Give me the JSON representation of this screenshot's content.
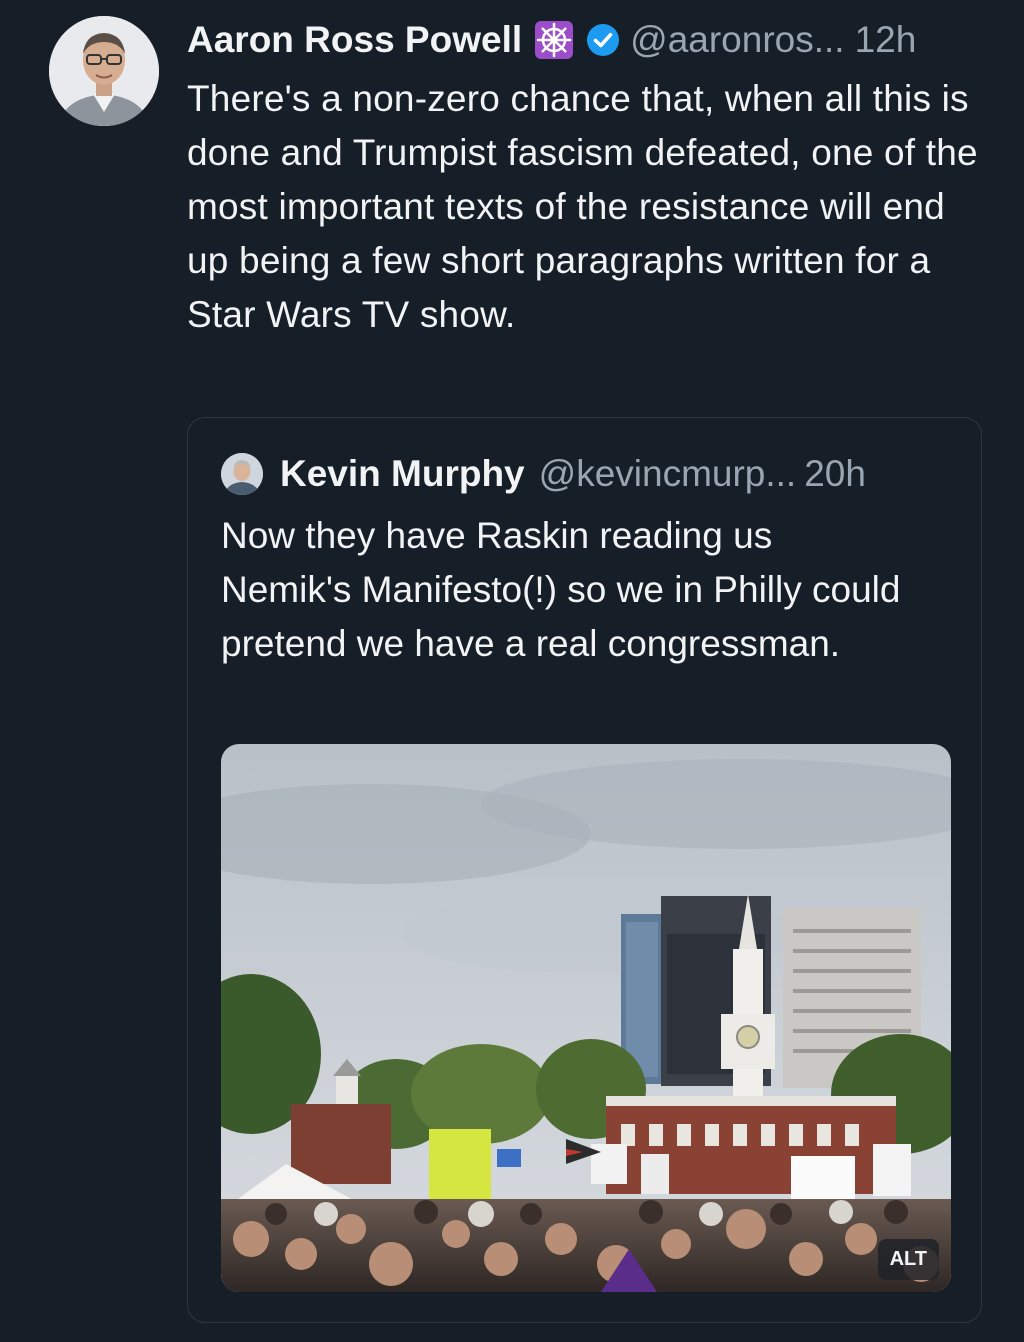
{
  "post": {
    "author": {
      "display_name": "Aaron Ross Powell",
      "handle": "@aaronros...",
      "verified_icon": "verified-check-icon",
      "extra_badge_icon": "ship-wheel-icon",
      "accent_color": "#9b4dca"
    },
    "timestamp": "12h",
    "text": "There's a non-zero chance that, when all this is done and Trumpist fascism defeated, one of the most important texts of the resistance will end up being a few short paragraphs written for a Star Wars TV show."
  },
  "quoted_post": {
    "author": {
      "display_name": "Kevin Murphy",
      "handle": "@kevincmurp..."
    },
    "timestamp": "20h",
    "text": "Now they have Raskin reading us Nemik's Manifesto(!) so we in Philly could pretend we have a real congressman.",
    "image": {
      "alt_badge": "ALT"
    }
  },
  "colors": {
    "background": "#161e27",
    "text": "#f1f3f5",
    "muted": "#9aa5b2",
    "verified": "#1d9bf0",
    "card_border": "#2c3744"
  }
}
